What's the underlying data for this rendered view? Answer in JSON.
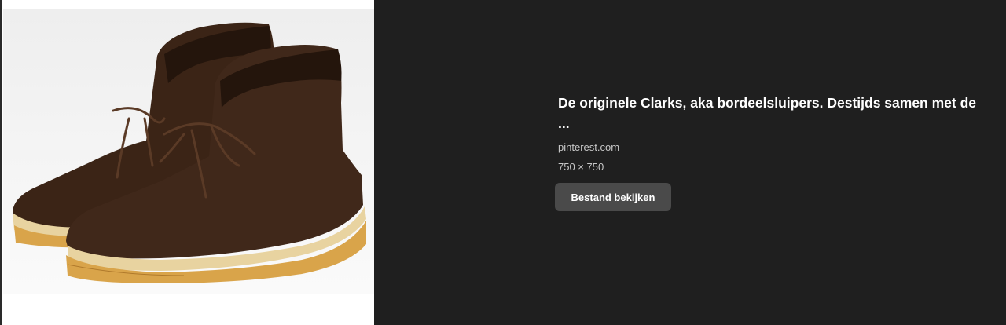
{
  "image": {
    "alt_subject": "brown-suede-desert-boots-icon",
    "colors": {
      "suede": "#3b2416",
      "suede_dark": "#24150c",
      "crepe_sole": "#d9a44a",
      "background": "#f2f2f2"
    }
  },
  "info": {
    "title": "De originele Clarks, aka bordeelsluipers. Destijds samen met de",
    "title_ellipsis": "...",
    "source": "pinterest.com",
    "dimensions": "750 × 750",
    "view_button_label": "Bestand bekijken"
  },
  "colors": {
    "panel_background": "#1f1f1f",
    "button_background": "#4a4a4a",
    "text_primary": "#ffffff",
    "text_secondary": "#c7c7c7"
  }
}
